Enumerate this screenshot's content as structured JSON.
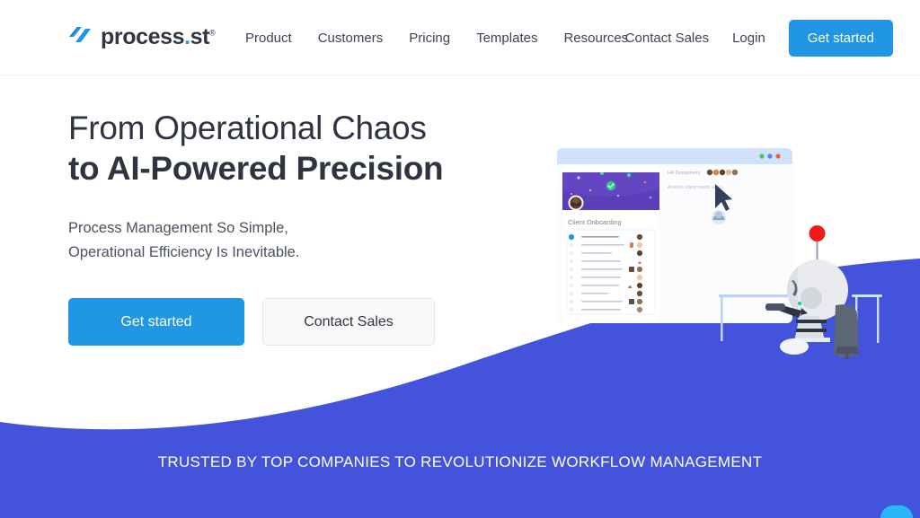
{
  "brand": {
    "logo_text": "process",
    "logo_dot": ".",
    "logo_suffix": "st",
    "logo_registered": "®",
    "accent_blue": "#2196e3",
    "indigo": "#4353dc",
    "heading_color": "#2e3440"
  },
  "header": {
    "nav": [
      {
        "label": "Product"
      },
      {
        "label": "Customers"
      },
      {
        "label": "Pricing"
      },
      {
        "label": "Templates"
      },
      {
        "label": "Resources"
      }
    ],
    "contact_sales": "Contact Sales",
    "login": "Login",
    "get_started": "Get started"
  },
  "hero": {
    "headline_line1": "From Operational Chaos",
    "headline_line2": "to AI-Powered Precision",
    "sub_line1": "Process Management So Simple,",
    "sub_line2": "Operational Efficiency Is Inevitable.",
    "cta_primary": "Get started",
    "cta_secondary": "Contact Sales"
  },
  "illustration": {
    "app_sidebar_title": "Client Onboarding",
    "app_breadcrumb": "HR Department",
    "app_task_text": "Analyse client needs and c",
    "window_dots": [
      "#4ac26b",
      "#4a90e2",
      "#e8604c"
    ]
  },
  "banner": {
    "text": "TRUSTED BY TOP COMPANIES TO REVOLUTIONIZE WORKFLOW MANAGEMENT"
  }
}
